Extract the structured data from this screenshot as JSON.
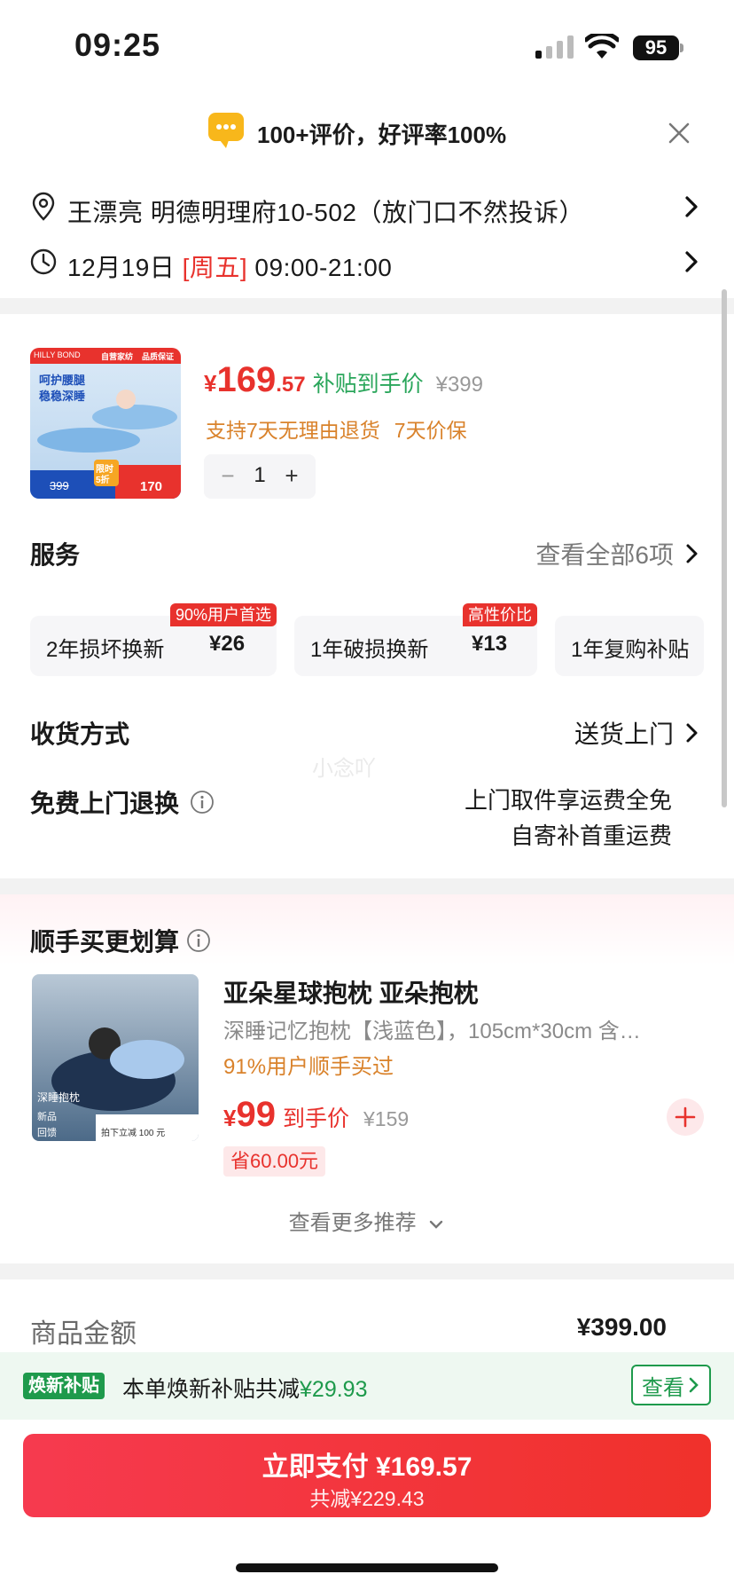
{
  "status_bar": {
    "time": "09:25",
    "battery": "95"
  },
  "review_banner": {
    "text": "100+评价，好评率100%"
  },
  "address": {
    "text": "王漂亮  明德明理府10-502（放门口不然投诉）"
  },
  "delivery_time": {
    "date": "12月19日",
    "weekday": "[周五]",
    "range": "09:00-21:00"
  },
  "product": {
    "image_texts": {
      "brand": "HILLY BOND",
      "tag1": "自营家纺",
      "tag2": "品质保证",
      "slogan1": "呵护腰腿",
      "slogan2": "稳稳深睡",
      "limit": "限时",
      "discount": "5折",
      "old_price": "399",
      "new_price": "170"
    },
    "price_yen": "¥",
    "price_int": "169",
    "price_dec": ".57",
    "price_label": "补贴到手价",
    "original_price": "¥399",
    "tags": [
      "支持7天无理由退货",
      "7天价保"
    ],
    "quantity": "1",
    "minus": "−",
    "plus": "+"
  },
  "services": {
    "title": "服务",
    "view_all": "查看全部6项",
    "items": [
      {
        "name": "2年损坏换新",
        "price": "¥26",
        "badge": "90%用户首选"
      },
      {
        "name": "1年破损换新",
        "price": "¥13",
        "badge": "高性价比"
      },
      {
        "name": "1年复购补贴",
        "price": "",
        "badge": ""
      }
    ]
  },
  "shipping": {
    "title": "收货方式",
    "value": "送货上门"
  },
  "returns": {
    "title": "免费上门退换",
    "line1": "上门取件享运费全免",
    "line2": "自寄补首重运费"
  },
  "watermark": "小念吖",
  "recommend": {
    "title": "顺手买更划算",
    "item": {
      "image_texts": {
        "label": "深睡抱枕",
        "new": "新品",
        "gift": "回馈",
        "promo": "拍下立减 100 元"
      },
      "title": "亚朵星球抱枕 亚朵抱枕",
      "desc": "深睡记忆抱枕【浅蓝色】，105cm*30cm 含…",
      "bought": "91%用户顺手买过",
      "price_yen": "¥",
      "price": "99",
      "price_label": "到手价",
      "original_price": "¥159",
      "save": "省60.00元"
    },
    "more": "查看更多推荐"
  },
  "summary": {
    "label": "商品金额",
    "value": "¥399.00"
  },
  "subsidy": {
    "tag": "焕新补贴",
    "text": "本单焕新补贴共减",
    "amount": "¥29.93",
    "view": "查看"
  },
  "pay": {
    "main": "立即支付 ¥169.57",
    "second": "共减¥229.43"
  },
  "colors": {
    "accent_red": "#e8322d",
    "green": "#1e9a4c",
    "orange": "#d9822b"
  }
}
